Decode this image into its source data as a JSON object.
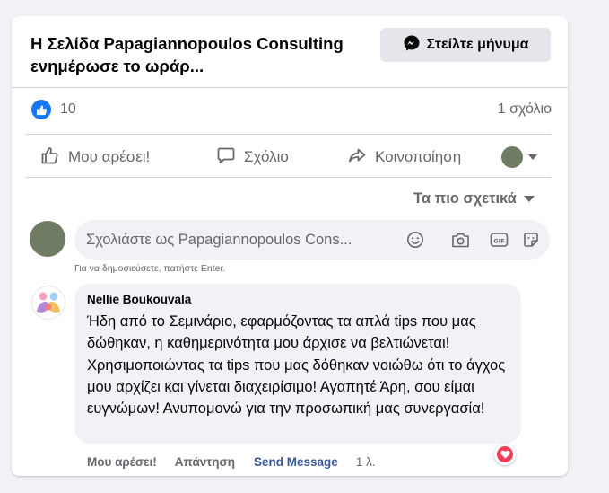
{
  "post": {
    "title": "Η Σελίδα Papagiannopoulos Consulting ενημέρωσε το ωράρ...",
    "send_message_label": "Στείλτε μήνυμα"
  },
  "stats": {
    "like_count": "10",
    "comment_count": "1 σχόλιο"
  },
  "actions": {
    "like_label": "Μου αρέσει!",
    "comment_label": "Σχόλιο",
    "share_label": "Κοινοποίηση"
  },
  "comments": {
    "sort_label": "Τα πιο σχετικά",
    "composer_placeholder": "Σχολιάστε ως Papagiannopoulos Cons...",
    "composer_hint": "Για να δημοσιεύσετε, πατήστε Enter.",
    "items": [
      {
        "author": "Nellie Boukouvala",
        "text": "Ήδη από το Σεμινάριο, εφαρμόζοντας τα απλά tips που μας δώθηκαν, η καθημερινότητα μου άρχισε να βελτιώνεται! Χρησιμοποιώντας τα tips που μας δόθηκαν νοιώθω ότι το άγχος μου αρχίζει και γίνεται διαχειρίσιμο! Αγαπητέ Άρη, σου είμαι ευγνώμων! Ανυπομονώ για την προσωπική μας συνεργασία!",
        "like_label": "Μου αρέσει!",
        "reply_label": "Απάντηση",
        "send_message_label": "Send Message",
        "age": "1 λ."
      }
    ]
  },
  "colors": {
    "accent": "#1877f2",
    "link": "#385898",
    "love": "#f33e58"
  }
}
